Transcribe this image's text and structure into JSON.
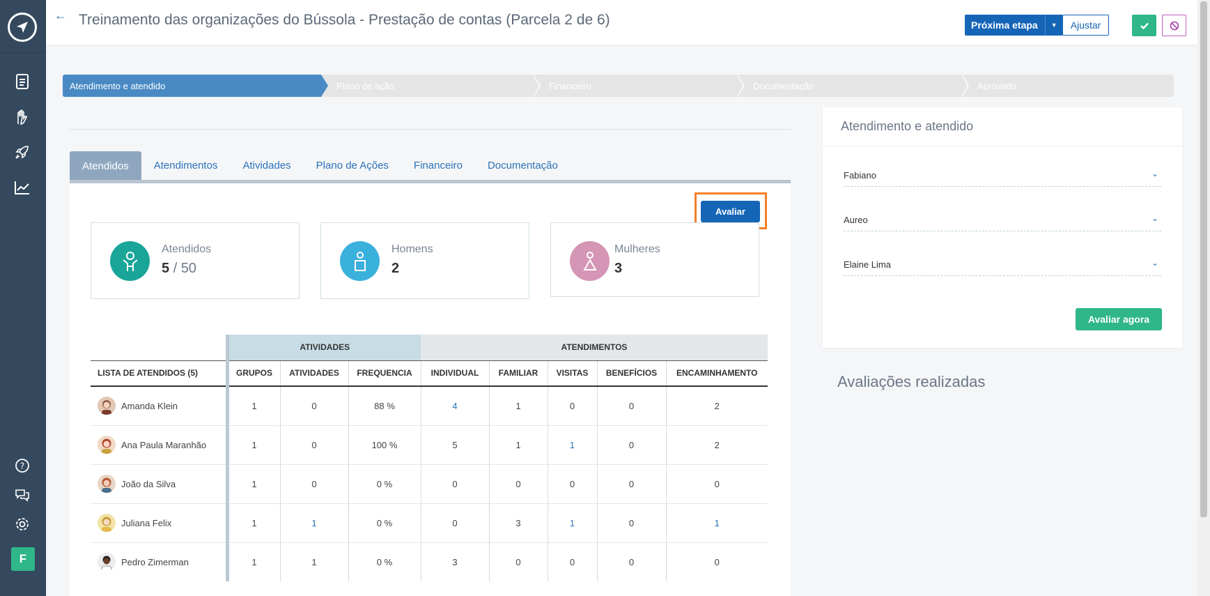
{
  "header": {
    "title": "Treinamento das organizações do Bússola - Prestação de contas (Parcela 2 de 6)",
    "next_step_label": "Próxima etapa",
    "adjust_label": "Ajustar"
  },
  "sidebar": {
    "icons": [
      "document-icon",
      "hand-heart-icon",
      "rocket-icon",
      "chart-icon"
    ],
    "bottom_icons": [
      "help-icon",
      "chat-icon",
      "settings-icon"
    ],
    "user_initial": "F"
  },
  "steps": [
    "Atendimento e atendido",
    "Plano de ação",
    "Financeiro",
    "Documentação",
    "Aprovado"
  ],
  "tabs": [
    "Atendidos",
    "Atendimentos",
    "Atividades",
    "Plano de Ações",
    "Financeiro",
    "Documentação"
  ],
  "avaliar_label": "Avaliar",
  "stats": {
    "atendidos": {
      "label": "Atendidos",
      "value": "5",
      "sep": "/",
      "total": "50"
    },
    "homens": {
      "label": "Homens",
      "value": "2"
    },
    "mulheres": {
      "label": "Mulheres",
      "value": "3"
    }
  },
  "table": {
    "group_atividades": "ATIVIDADES",
    "group_atendimentos": "ATENDIMENTOS",
    "list_header": "LISTA DE ATENDIDOS (5)",
    "columns": [
      "GRUPOS",
      "ATIVIDADES",
      "FREQUENCIA",
      "INDIVIDUAL",
      "FAMILIAR",
      "VISITAS",
      "BENEFÍCIOS",
      "ENCAMINHAMENTO"
    ],
    "rows": [
      {
        "name": "Amanda Klein",
        "cells": [
          "1",
          "0",
          "88 %",
          "4",
          "1",
          "0",
          "0",
          "2"
        ]
      },
      {
        "name": "Ana Paula Maranhão",
        "cells": [
          "1",
          "0",
          "100 %",
          "5",
          "1",
          "1",
          "0",
          "2"
        ]
      },
      {
        "name": "João da Silva",
        "cells": [
          "1",
          "0",
          "0 %",
          "0",
          "0",
          "0",
          "0",
          "0"
        ]
      },
      {
        "name": "Juliana Felix",
        "cells": [
          "1",
          "1",
          "0 %",
          "0",
          "3",
          "1",
          "0",
          "1"
        ]
      },
      {
        "name": "Pedro Zimerman",
        "cells": [
          "1",
          "1",
          "0 %",
          "3",
          "0",
          "0",
          "0",
          "0"
        ]
      }
    ]
  },
  "right_panel": {
    "title": "Atendimento e atendido",
    "dropdowns": [
      "Fabiano",
      "Aureo",
      "Elaine Lima"
    ],
    "evaluate_now_label": "Avaliar agora",
    "evaluations_heading": "Avaliações realizadas"
  },
  "colors": {
    "sidebar": "#34495e",
    "primary": "#1565b7",
    "success": "#2fb689",
    "step_active": "#4a8ac4",
    "highlight": "#f57f29",
    "atendidos_icon": "#1aa599",
    "homens_icon": "#3ab0dc",
    "mulheres_icon": "#d595b4"
  }
}
